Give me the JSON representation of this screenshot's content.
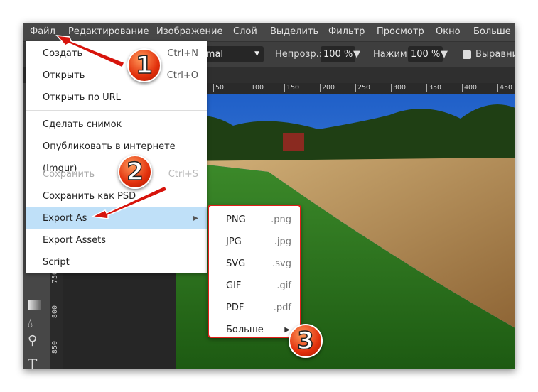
{
  "menubar": {
    "items": [
      "Файл",
      "Редактирование",
      "Изображение",
      "Слой",
      "Выделить",
      "Фильтр",
      "Просмотр",
      "Окно",
      "Больше"
    ]
  },
  "toolbar": {
    "blend_mode": "Normal",
    "opacity_label": "Непрозр.:",
    "opacity_value": "100 %",
    "flow_label": "Нажим:",
    "flow_value": "100 %",
    "align_label": "Выравни"
  },
  "ruler": {
    "h": [
      "50",
      "100",
      "150",
      "200",
      "250",
      "300",
      "350",
      "400",
      "450"
    ],
    "v": [
      "750",
      "800",
      "850"
    ]
  },
  "file_menu": {
    "items": [
      {
        "label": "Создать",
        "shortcut": "Ctrl+N"
      },
      {
        "label": "Открыть",
        "shortcut": "Ctrl+O"
      },
      {
        "label": "Открыть по URL",
        "shortcut": ""
      },
      {
        "label": "Сделать снимок",
        "shortcut": ""
      },
      {
        "label": "Опубликовать в интернете (Imgur)",
        "shortcut": ""
      },
      {
        "label": "Сохранить",
        "shortcut": "Ctrl+S",
        "disabled": true
      },
      {
        "label": "Сохранить как PSD",
        "shortcut": ""
      },
      {
        "label": "Export As",
        "shortcut": "▶",
        "highlighted": true
      },
      {
        "label": "Export Assets",
        "shortcut": ""
      },
      {
        "label": "Script",
        "shortcut": ""
      }
    ]
  },
  "export_submenu": {
    "items": [
      {
        "label": "PNG",
        "ext": ".png"
      },
      {
        "label": "JPG",
        "ext": ".jpg"
      },
      {
        "label": "SVG",
        "ext": ".svg"
      },
      {
        "label": "GIF",
        "ext": ".gif"
      },
      {
        "label": "PDF",
        "ext": ".pdf"
      },
      {
        "label": "Больше",
        "ext": "▶"
      }
    ]
  },
  "annotations": {
    "badges": [
      "1",
      "2",
      "3"
    ],
    "color": "#e0201a"
  }
}
